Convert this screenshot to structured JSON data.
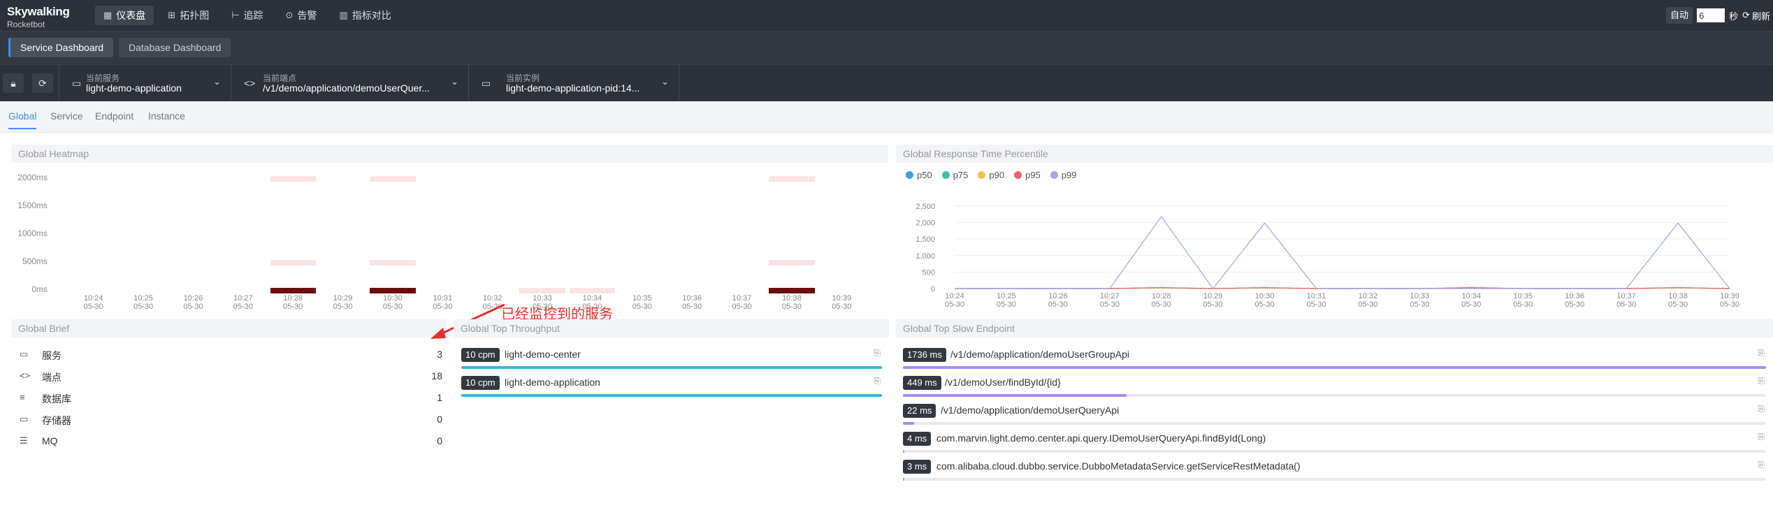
{
  "topbar": {
    "logo_line1": "Skywalking",
    "logo_line2": "Rocketbot",
    "nav": [
      {
        "label": "仪表盘",
        "icon": "dashboard-icon",
        "glyph": "▦",
        "active": true
      },
      {
        "label": "拓扑图",
        "icon": "topology-icon",
        "glyph": "⊞",
        "active": false
      },
      {
        "label": "追踪",
        "icon": "trace-icon",
        "glyph": "⊢",
        "active": false
      },
      {
        "label": "告警",
        "icon": "alarm-icon",
        "glyph": "⊙",
        "active": false
      },
      {
        "label": "指标对比",
        "icon": "compare-icon",
        "glyph": "▥",
        "active": false
      }
    ],
    "auto_label": "自动",
    "interval_value": "6",
    "seconds_label": "秒",
    "refresh_label": "刷新"
  },
  "dashboards": [
    {
      "label": "Service Dashboard",
      "active": true
    },
    {
      "label": "Database Dashboard",
      "active": false
    }
  ],
  "selectors": {
    "service": {
      "label": "当前服务",
      "value": "light-demo-application"
    },
    "endpoint": {
      "label": "当前端点",
      "value": "/v1/demo/application/demoUserQuer..."
    },
    "instance": {
      "label": "当前实例",
      "value": "light-demo-application-pid:14..."
    }
  },
  "subtabs": [
    "Global",
    "Service",
    "Endpoint",
    "Instance"
  ],
  "heatmap": {
    "title": "Global Heatmap",
    "y_labels": [
      "2000ms",
      "1500ms",
      "1000ms",
      "500ms",
      "0ms"
    ],
    "x_labels": [
      [
        "10:24",
        "05-30"
      ],
      [
        "10:25",
        "05-30"
      ],
      [
        "10:26",
        "05-30"
      ],
      [
        "10:27",
        "05-30"
      ],
      [
        "10:28",
        "05-30"
      ],
      [
        "10:29",
        "05-30"
      ],
      [
        "10:30",
        "05-30"
      ],
      [
        "10:31",
        "05-30"
      ],
      [
        "10:32",
        "05-30"
      ],
      [
        "10:33",
        "05-30"
      ],
      [
        "10:34",
        "05-30"
      ],
      [
        "10:35",
        "05-30"
      ],
      [
        "10:36",
        "05-30"
      ],
      [
        "10:37",
        "05-30"
      ],
      [
        "10:38",
        "05-30"
      ],
      [
        "10:39",
        "05-30"
      ]
    ]
  },
  "brief": {
    "title": "Global Brief",
    "rows": [
      {
        "label": "服务",
        "value": "3",
        "icon": "service-icon",
        "glyph": "▭"
      },
      {
        "label": "端点",
        "value": "18",
        "icon": "endpoint-icon",
        "glyph": "<>"
      },
      {
        "label": "数据库",
        "value": "1",
        "icon": "database-icon",
        "glyph": "≡"
      },
      {
        "label": "存储器",
        "value": "0",
        "icon": "cache-icon",
        "glyph": "▭"
      },
      {
        "label": "MQ",
        "value": "0",
        "icon": "mq-icon",
        "glyph": "☰"
      }
    ]
  },
  "annotation": "已经监控到的服务",
  "throughput": {
    "title": "Global Top Throughput",
    "items": [
      {
        "badge": "10 cpm",
        "name": "light-demo-center",
        "fraction": 1.0
      },
      {
        "badge": "10 cpm",
        "name": "light-demo-application",
        "fraction": 1.0
      }
    ]
  },
  "percentile": {
    "title": "Global Response Time Percentile"
  },
  "slow": {
    "title": "Global Top Slow Endpoint",
    "items": [
      {
        "badge": "1736 ms",
        "name": "/v1/demo/application/demoUserGroupApi",
        "fraction": 1.0
      },
      {
        "badge": "449 ms",
        "name": "/v1/demoUser/findById/{id}",
        "fraction": 0.259
      },
      {
        "badge": "22 ms",
        "name": "/v1/demo/application/demoUserQueryApi",
        "fraction": 0.013
      },
      {
        "badge": "4 ms",
        "name": "com.marvin.light.demo.center.api.query.IDemoUserQueryApi.findById(Long)",
        "fraction": 0.002
      },
      {
        "badge": "3 ms",
        "name": "com.alibaba.cloud.dubbo.service.DubboMetadataService.getServiceRestMetadata()",
        "fraction": 0.002
      }
    ]
  },
  "colors": {
    "accent": "#448dfe",
    "throughput_bar": "#3fb1e3",
    "slow_bar": "#a78bfa",
    "heat_dark": "#6b0d0d",
    "heat_light": "#fbe3e3"
  },
  "chart_data": [
    {
      "type": "heatmap",
      "title": "Global Heatmap",
      "x": [
        "10:24",
        "10:25",
        "10:26",
        "10:27",
        "10:28",
        "10:29",
        "10:30",
        "10:31",
        "10:32",
        "10:33",
        "10:34",
        "10:35",
        "10:36",
        "10:37",
        "10:38",
        "10:39"
      ],
      "y_buckets": [
        "0ms",
        "500ms",
        "1000ms",
        "1500ms",
        "2000ms"
      ],
      "cells": [
        {
          "x": "10:28",
          "bucket": "0ms",
          "level": "high"
        },
        {
          "x": "10:28",
          "bucket": "500ms",
          "level": "low"
        },
        {
          "x": "10:28",
          "bucket": "2000ms",
          "level": "low"
        },
        {
          "x": "10:30",
          "bucket": "0ms",
          "level": "high"
        },
        {
          "x": "10:30",
          "bucket": "500ms",
          "level": "low"
        },
        {
          "x": "10:30",
          "bucket": "2000ms",
          "level": "low"
        },
        {
          "x": "10:33",
          "bucket": "0ms",
          "level": "low"
        },
        {
          "x": "10:34",
          "bucket": "0ms",
          "level": "low"
        },
        {
          "x": "10:38",
          "bucket": "0ms",
          "level": "high"
        },
        {
          "x": "10:38",
          "bucket": "500ms",
          "level": "low"
        },
        {
          "x": "10:38",
          "bucket": "2000ms",
          "level": "low"
        }
      ]
    },
    {
      "type": "line",
      "title": "Global Response Time Percentile",
      "x": [
        "10:24",
        "10:25",
        "10:26",
        "10:27",
        "10:28",
        "10:29",
        "10:30",
        "10:31",
        "10:32",
        "10:33",
        "10:34",
        "10:35",
        "10:36",
        "10:37",
        "10:38",
        "10:39"
      ],
      "x_sub": "05-30",
      "ylim": [
        0,
        2500
      ],
      "y_ticks": [
        0,
        500,
        1000,
        1500,
        2000,
        2500
      ],
      "legend_position": "top-left",
      "series": [
        {
          "name": "p50",
          "color": "#3a9de0",
          "values": [
            0,
            0,
            0,
            0,
            20,
            0,
            20,
            0,
            0,
            0,
            10,
            0,
            0,
            0,
            20,
            0
          ]
        },
        {
          "name": "p75",
          "color": "#3fbfa8",
          "values": [
            0,
            0,
            0,
            0,
            20,
            0,
            20,
            0,
            0,
            0,
            20,
            0,
            0,
            0,
            20,
            0
          ]
        },
        {
          "name": "p90",
          "color": "#f6c344",
          "values": [
            0,
            0,
            0,
            0,
            20,
            0,
            20,
            0,
            0,
            0,
            20,
            0,
            0,
            0,
            20,
            0
          ]
        },
        {
          "name": "p95",
          "color": "#f25d73",
          "values": [
            0,
            0,
            0,
            0,
            30,
            0,
            30,
            0,
            0,
            0,
            30,
            0,
            0,
            0,
            30,
            0
          ]
        },
        {
          "name": "p99",
          "color": "#a3a5e8",
          "values": [
            0,
            0,
            0,
            0,
            2180,
            0,
            1990,
            0,
            0,
            0,
            0,
            0,
            0,
            0,
            1990,
            0
          ]
        }
      ]
    }
  ]
}
